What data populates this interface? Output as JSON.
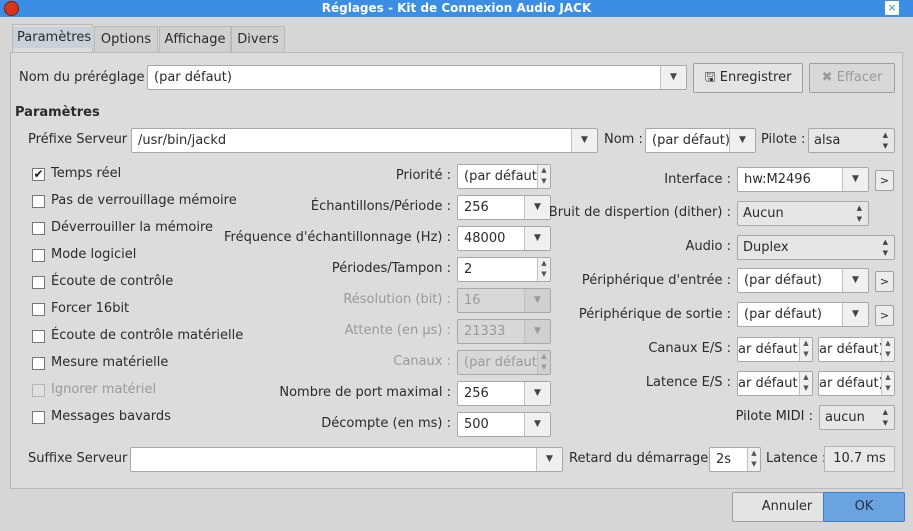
{
  "window": {
    "title": "Réglages - Kit de Connexion Audio JACK",
    "close": "×"
  },
  "tabs": [
    "Paramètres",
    "Options",
    "Affichage",
    "Divers"
  ],
  "preset": {
    "label": "Nom du préréglage :",
    "value": "(par défaut)",
    "save": "Enregistrer",
    "delete": "Effacer"
  },
  "section": "Paramètres",
  "server": {
    "prefix_label": "Préfixe Serveur :",
    "prefix_value": "/usr/bin/jackd",
    "name_label": "Nom :",
    "name_value": "(par défaut)",
    "driver_label": "Pilote :",
    "driver_value": "alsa"
  },
  "checkboxes": [
    {
      "label": "Temps réel",
      "checked": true,
      "disabled": false
    },
    {
      "label": "Pas de verrouillage mémoire",
      "checked": false,
      "disabled": false
    },
    {
      "label": "Déverrouiller la mémoire",
      "checked": false,
      "disabled": false
    },
    {
      "label": "Mode logiciel",
      "checked": false,
      "disabled": false
    },
    {
      "label": "Écoute de contrôle",
      "checked": false,
      "disabled": false
    },
    {
      "label": "Forcer 16bit",
      "checked": false,
      "disabled": false
    },
    {
      "label": "Écoute de contrôle matérielle",
      "checked": false,
      "disabled": false
    },
    {
      "label": "Mesure matérielle",
      "checked": false,
      "disabled": false
    },
    {
      "label": "Ignorer matériel",
      "checked": false,
      "disabled": true
    },
    {
      "label": "Messages bavards",
      "checked": false,
      "disabled": false
    }
  ],
  "mid": [
    {
      "label": "Priorité :",
      "value": "(par défaut)",
      "kind": "spin"
    },
    {
      "label": "Échantillons/Période :",
      "value": "256",
      "kind": "combo"
    },
    {
      "label": "Fréquence d'échantillonnage (Hz) :",
      "value": "48000",
      "kind": "combo"
    },
    {
      "label": "Périodes/Tampon :",
      "value": "2",
      "kind": "spin"
    },
    {
      "label": "Résolution (bit) :",
      "value": "16",
      "kind": "combo",
      "disabled": true
    },
    {
      "label": "Attente (en µs) :",
      "value": "21333",
      "kind": "combo",
      "disabled": true
    },
    {
      "label": "Canaux :",
      "value": "(par défaut)",
      "kind": "spin",
      "disabled": true
    },
    {
      "label": "Nombre de port maximal :",
      "value": "256",
      "kind": "combo"
    },
    {
      "label": "Décompte (en ms) :",
      "value": "500",
      "kind": "combo"
    }
  ],
  "right": {
    "interface_label": "Interface :",
    "interface_value": "hw:M2496",
    "dither_label": "Bruit de dispertion (dither) :",
    "dither_value": "Aucun",
    "audio_label": "Audio :",
    "audio_value": "Duplex",
    "in_label": "Périphérique d'entrée :",
    "in_value": "(par défaut)",
    "out_label": "Périphérique de sortie :",
    "out_value": "(par défaut)",
    "chan_label": "Canaux E/S :",
    "chan_in": "ar défaut)",
    "chan_out": "ar défaut)",
    "lat_label": "Latence E/S :",
    "lat_in": "ar défaut)",
    "lat_out": "ar défaut)",
    "midi_label": "Pilote MIDI :",
    "midi_value": "aucun",
    "more": ">"
  },
  "bottom": {
    "suffix_label": "Suffixe Serveur :",
    "suffix_value": "",
    "delay_label": "Retard du démarrage :",
    "delay_value": "2s",
    "latency_label": "Latence :",
    "latency_value": "10.7 ms"
  },
  "dialog": {
    "cancel": "Annuler",
    "ok": "OK"
  }
}
